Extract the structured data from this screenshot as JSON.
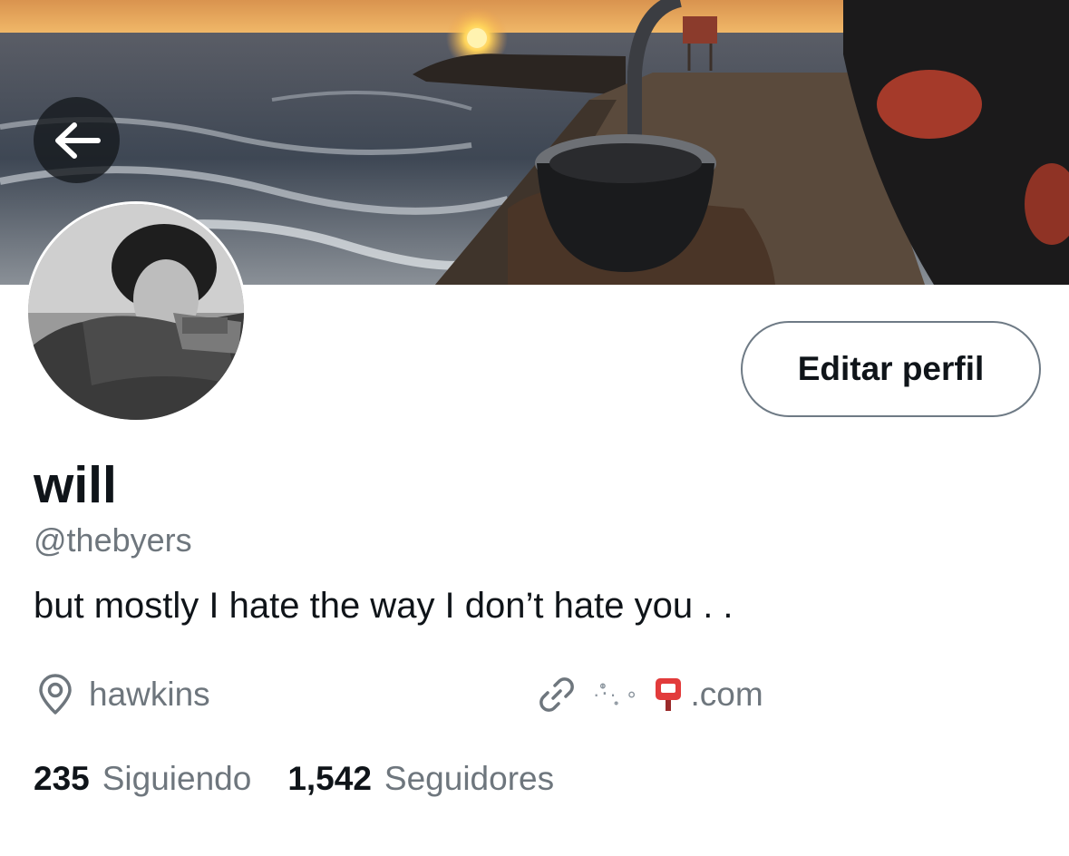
{
  "profile": {
    "display_name": "will",
    "handle": "@thebyers",
    "bio": "but mostly I hate the way I don’t hate you . .",
    "location": "hawkins",
    "website_decor": "·‧̍̊·̩̥ ∘",
    "website_suffix": ".com"
  },
  "actions": {
    "edit_profile_label": "Editar perfil"
  },
  "stats": {
    "following_count": "235",
    "following_label": "Siguiendo",
    "followers_count": "1,542",
    "followers_label": "Seguidores"
  },
  "icons": {
    "back": "arrow-left-icon",
    "location": "location-pin-icon",
    "link": "link-icon",
    "mailbox": "mailbox-emoji-icon"
  },
  "colors": {
    "text_primary": "#0f1419",
    "text_secondary": "#6e767d",
    "button_border": "#6e7a85"
  }
}
